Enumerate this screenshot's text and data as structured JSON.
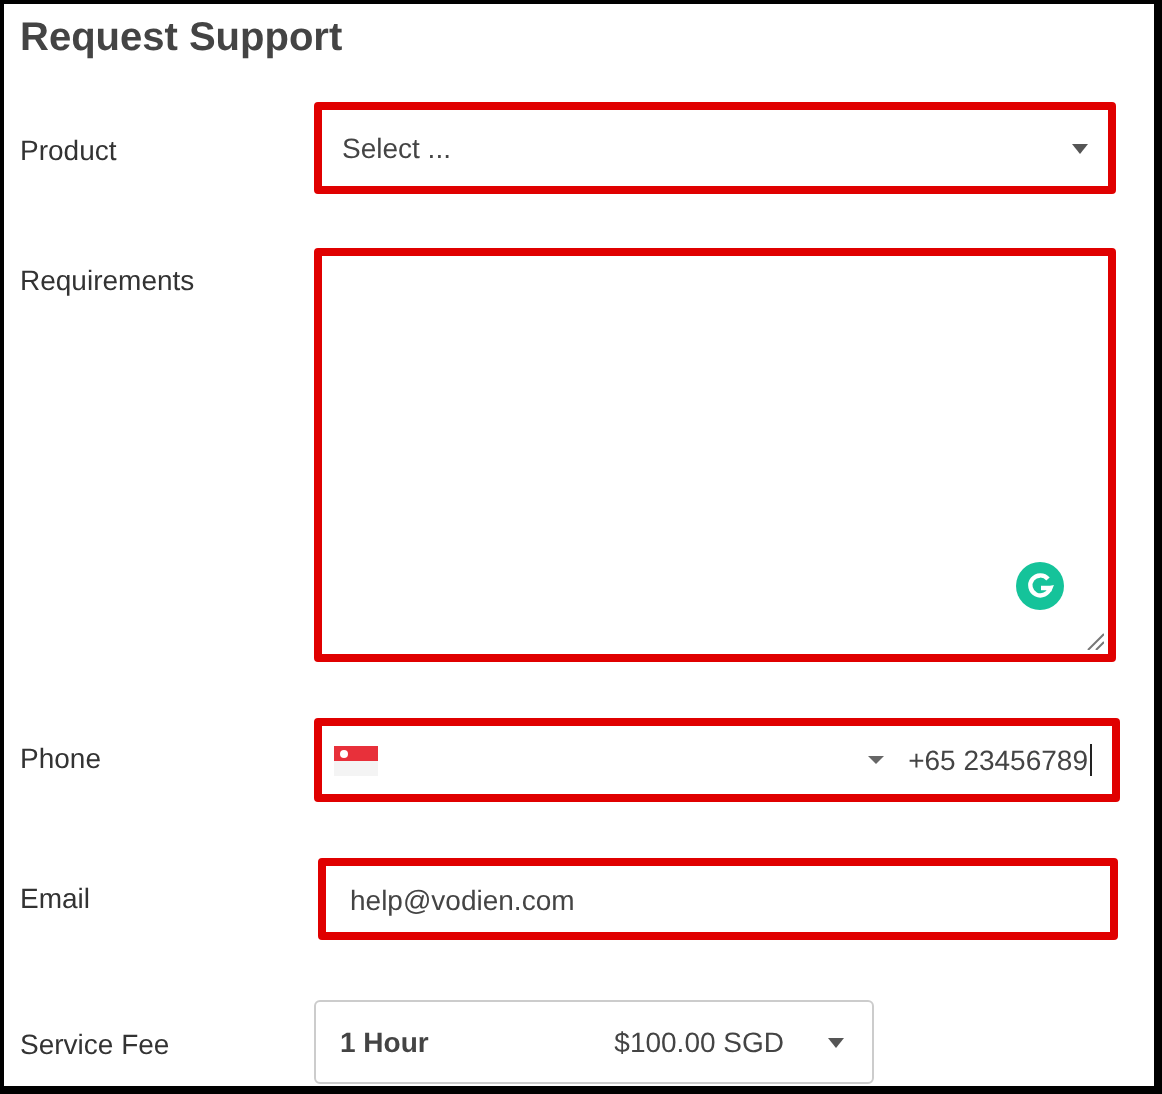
{
  "title": "Request Support",
  "fields": [
    {
      "kind": "select",
      "label": "Product",
      "placeholder": "Select ...",
      "highlighted": true
    },
    {
      "kind": "textarea",
      "label": "Requirements",
      "highlighted": true
    },
    {
      "kind": "phone",
      "label": "Phone",
      "value": "+65 23456789",
      "highlighted": true
    },
    {
      "kind": "text",
      "label": "Email",
      "value": "help@vodien.com",
      "highlighted": true
    },
    {
      "kind": "fee",
      "label": "Service Fee",
      "option": "1 Hour",
      "price": "$100.00 SGD",
      "highlighted": false
    }
  ]
}
